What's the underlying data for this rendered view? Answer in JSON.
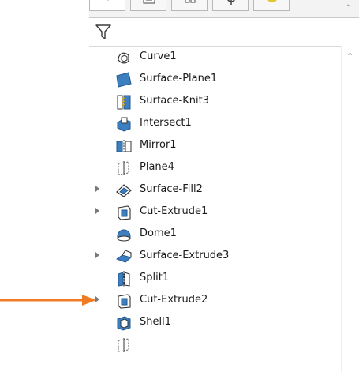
{
  "tree": {
    "items": [
      {
        "label": "Curve1",
        "icon": "curve-icon",
        "expandable": false
      },
      {
        "label": "Surface-Plane1",
        "icon": "surface-plane-icon",
        "expandable": false
      },
      {
        "label": "Surface-Knit3",
        "icon": "surface-knit-icon",
        "expandable": false
      },
      {
        "label": "Intersect1",
        "icon": "intersect-icon",
        "expandable": false
      },
      {
        "label": "Mirror1",
        "icon": "mirror-icon",
        "expandable": false
      },
      {
        "label": "Plane4",
        "icon": "plane-icon",
        "expandable": false
      },
      {
        "label": "Surface-Fill2",
        "icon": "surface-fill-icon",
        "expandable": true
      },
      {
        "label": "Cut-Extrude1",
        "icon": "cut-extrude-icon",
        "expandable": true
      },
      {
        "label": "Dome1",
        "icon": "dome-icon",
        "expandable": false
      },
      {
        "label": "Surface-Extrude3",
        "icon": "surface-extrude-icon",
        "expandable": true
      },
      {
        "label": "Split1",
        "icon": "split-icon",
        "expandable": false
      },
      {
        "label": "Cut-Extrude2",
        "icon": "cut-extrude-icon",
        "expandable": true
      },
      {
        "label": "Shell1",
        "icon": "shell-icon",
        "expandable": false
      }
    ]
  },
  "tabs": [
    {
      "icon": "feature-manager-icon"
    },
    {
      "icon": "property-manager-icon"
    },
    {
      "icon": "configuration-manager-icon"
    },
    {
      "icon": "dimxpert-icon"
    },
    {
      "icon": "display-manager-icon"
    }
  ],
  "filter": {
    "icon": "filter-icon"
  },
  "colors": {
    "accent_arrow": "#f07b22",
    "icon_blue": "#3c7fc1"
  }
}
